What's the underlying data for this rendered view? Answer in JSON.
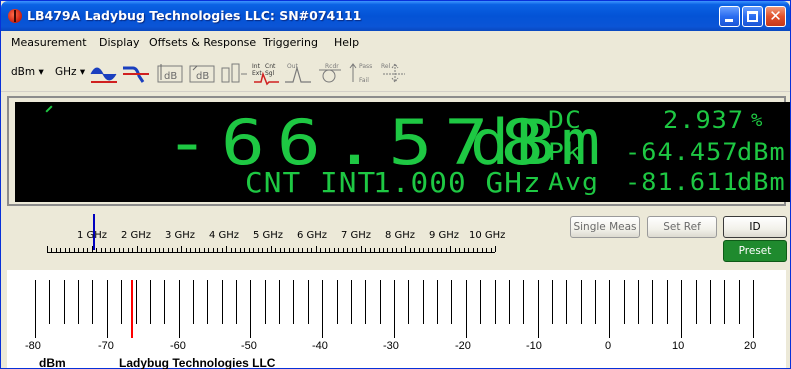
{
  "window": {
    "title": "LB479A Ladybug Technologies LLC: SN#074111",
    "close_glyph": "✕"
  },
  "menu": {
    "items": [
      "Measurement",
      "Display",
      "Offsets & Response",
      "Triggering",
      "Help"
    ]
  },
  "toolbar": {
    "unit_select": "dBm",
    "freq_select": "GHz",
    "icons": [
      "sine-wave-icon",
      "filter-response-icon",
      "offset-db-icon",
      "offset-db-2-icon",
      "averaging-icon",
      "trigger-int-ext-icon",
      "output-icon",
      "reset-icon",
      "pass-fail-icon",
      "relative-icon"
    ],
    "icon_texts": {
      "db1": "dB",
      "db2": "dB",
      "int": "Int",
      "ext": "Ext",
      "cnt": "Cnt",
      "sgl": "Sgl",
      "out": "Out",
      "rcdr": "Rcdr",
      "pass": "Pass",
      "fail": "Fail",
      "rel": "Rel"
    }
  },
  "display": {
    "main_value": "-66.578",
    "main_unit": "dBm",
    "mode": "CNT INT",
    "frequency": "1.000 GHz",
    "readouts": [
      {
        "label": "DC",
        "value": "2.937",
        "unit": "%"
      },
      {
        "label": "Pk",
        "value": "-64.457",
        "unit": "dBm"
      },
      {
        "label": "Avg",
        "value": "-81.611",
        "unit": "dBm"
      }
    ],
    "color": "#1ec843"
  },
  "freq_scale": {
    "labels": [
      "1 GHz",
      "2 GHz",
      "3 GHz",
      "4 GHz",
      "5 GHz",
      "6 GHz",
      "7 GHz",
      "8 GHz",
      "9 GHz",
      "10 GHz"
    ],
    "marker_color": "#0000c0"
  },
  "buttons": {
    "single_meas": "Single Meas",
    "set_ref": "Set Ref",
    "id": "ID",
    "preset": "Preset"
  },
  "bar_graph": {
    "labels": [
      "-80",
      "-70",
      "-60",
      "-50",
      "-40",
      "-30",
      "-20",
      "-10",
      "0",
      "10",
      "20"
    ],
    "unit": "dBm",
    "company": "Ladybug Technologies LLC",
    "marker_value": -66.578,
    "marker_color": "#ff0000"
  }
}
